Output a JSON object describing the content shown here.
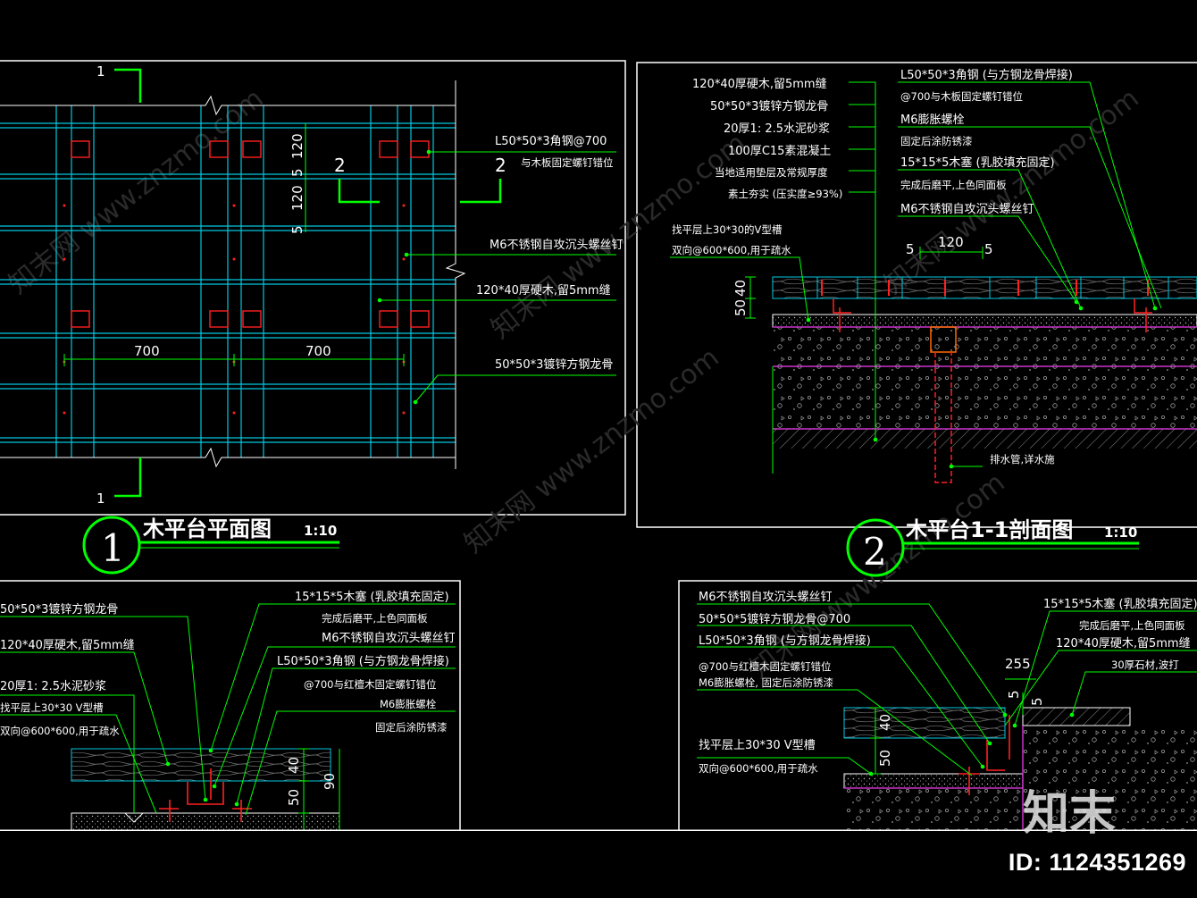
{
  "titles": {
    "plan": "木平台平面图",
    "plan_scale": "1:10",
    "plan_number": "1",
    "section": "木平台1-1剖面图",
    "section_scale": "1:10",
    "section_number": "2"
  },
  "plan": {
    "cut_mark_1": "1",
    "cut_mark_2": "2",
    "dims": {
      "spacing_1": "700",
      "spacing_2": "700",
      "board_1": "120",
      "gap_1": "5",
      "board_2": "120",
      "gap_2": "5"
    },
    "notes": [
      "L50*50*3角钢@700",
      "与木板固定螺钉错位",
      "M6不锈钢自攻沉头螺丝钉",
      "120*40厚硬木,留5mm缝",
      "50*50*3镀锌方钢龙骨"
    ]
  },
  "section": {
    "notes_left": [
      "120*40厚硬木,留5mm缝",
      "50*50*3镀锌方钢龙骨",
      "20厚1: 2.5水泥砂浆",
      "100厚C15素混凝土",
      "当地适用垫层及常规厚度",
      "素土夯实 (压实度≥93%)"
    ],
    "notes_right": [
      "L50*50*3角钢 (与方钢龙骨焊接)",
      "@700与木板固定螺钉错位",
      "M6膨胀螺栓",
      "固定后涂防锈漆",
      "15*15*5木塞 (乳胶填充固定)",
      "完成后磨平,上色同面板",
      "M6不锈钢自攻沉头螺丝钉"
    ],
    "notes_mid": [
      "找平层上30*30的V型槽",
      "双向@600*600,用于疏水"
    ],
    "dims": {
      "width": "120",
      "gap_l": "5",
      "gap_r": "5",
      "thick_1": "50",
      "thick_2": "40"
    },
    "drain": "排水管,详水施"
  },
  "detail_a": {
    "notes_left": [
      "50*50*3镀锌方钢龙骨",
      "120*40厚硬木,留5mm缝",
      "20厚1: 2.5水泥砂浆",
      "找平层上30*30 V型槽",
      "双向@600*600,用于疏水"
    ],
    "notes_right": [
      "15*15*5木塞 (乳胶填充固定)",
      "完成后磨平,上色同面板",
      "M6不锈钢自攻沉头螺丝钉",
      "L50*50*3角钢 (与方钢龙骨焊接)",
      "@700与红檀木固定螺钉错位",
      "M6膨胀螺栓",
      "固定后涂防锈漆"
    ],
    "dims": {
      "d40": "40",
      "d50": "50",
      "d90": "90"
    }
  },
  "detail_b": {
    "notes_left": [
      "M6不锈钢自攻沉头螺丝钉",
      "50*50*5镀锌方钢龙骨@700",
      "L50*50*3角钢 (与方钢龙骨焊接)",
      "@700与红檀木固定螺钉错位",
      "M6膨胀螺栓, 固定后涂防锈漆",
      "找平层上30*30 V型槽",
      "双向@600*600,用于疏水"
    ],
    "notes_right": [
      "15*15*5木塞 (乳胶填充固定)",
      "完成后磨平,上色同面板",
      "120*40厚硬木,留5mm缝",
      "30厚石材,波打"
    ],
    "dims": {
      "d255": "255",
      "d5a": "5",
      "d5b": "5",
      "d40": "40",
      "d50": "50"
    }
  },
  "footer": {
    "id_label": "ID: 1124351269",
    "brand": "知末"
  },
  "colors": {
    "background": "#000000",
    "leader": "#00ff00",
    "steel": "#00c8e0",
    "bolt": "#ff2020",
    "frame": "#ffffff",
    "layer": "#cc33cc"
  }
}
